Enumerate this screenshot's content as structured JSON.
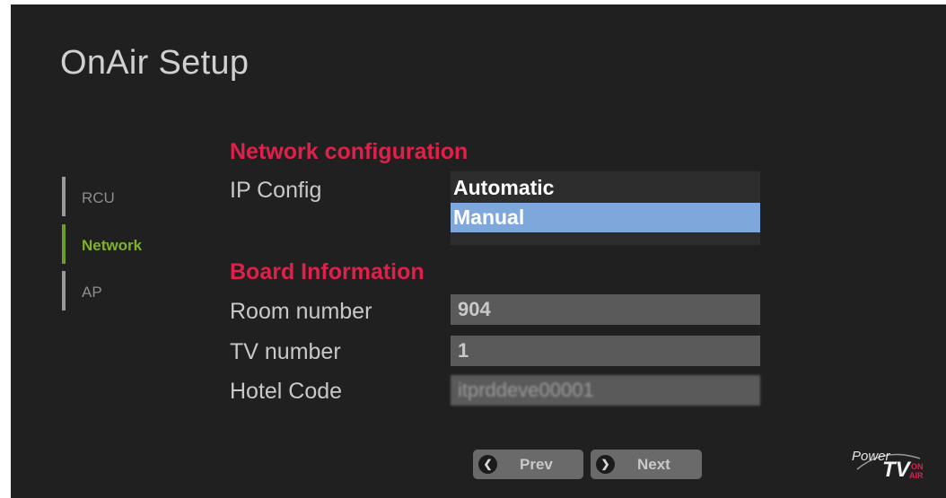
{
  "header": {
    "title": "OnAir Setup"
  },
  "sidebar": {
    "items": [
      {
        "label": "RCU",
        "active": false
      },
      {
        "label": "Network",
        "active": true
      },
      {
        "label": "AP",
        "active": false
      }
    ]
  },
  "network": {
    "heading": "Network configuration",
    "ip_config_label": "IP Config",
    "ip_options": [
      "Automatic",
      "Manual"
    ],
    "ip_selected": "Manual"
  },
  "board": {
    "heading": "Board Information",
    "room_label": "Room number",
    "room_value": "904",
    "tv_label": "TV number",
    "tv_value": "1",
    "hotel_label": "Hotel Code",
    "hotel_value": "itprddeve00001"
  },
  "footer": {
    "prev_label": "Prev",
    "next_label": "Next"
  },
  "logo": {
    "power": "Power",
    "tv": "TV",
    "on": "ON",
    "air": "AIR"
  },
  "colors": {
    "accent_red": "#e0204a",
    "active_green": "#7fb12f",
    "selection_blue": "#7ea7dc",
    "background": "#202020"
  }
}
